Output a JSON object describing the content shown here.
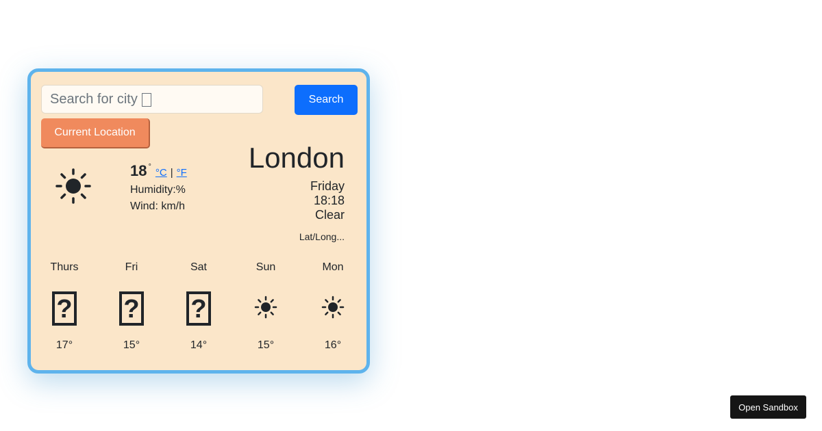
{
  "search": {
    "placeholder": "Search for city",
    "placeholder_glyph": "?",
    "button_label": "Search"
  },
  "location_button_label": "Current Location",
  "current": {
    "icon": "sun-icon",
    "temperature": "18",
    "degree_symbol": "°",
    "unit_celsius": "°C",
    "unit_separator": "|",
    "unit_fahrenheit": "°F",
    "humidity": "Humidity:%",
    "wind": "Wind: km/h",
    "city": "London",
    "day": "Friday",
    "time": "18:18",
    "description": "Clear",
    "latlong": "Lat/Long..."
  },
  "forecast": [
    {
      "day": "Thurs",
      "temp": "17°",
      "icon": "missing-glyph-icon"
    },
    {
      "day": "Fri",
      "temp": "15°",
      "icon": "missing-glyph-icon"
    },
    {
      "day": "Sat",
      "temp": "14°",
      "icon": "missing-glyph-icon"
    },
    {
      "day": "Sun",
      "temp": "15°",
      "icon": "sun-icon"
    },
    {
      "day": "Mon",
      "temp": "16°",
      "icon": "sun-icon"
    }
  ],
  "sandbox_button_label": "Open Sandbox",
  "colors": {
    "card_background": "#fbe6c9",
    "card_border": "#5eb3ec",
    "search_button": "#0d6efd",
    "location_button": "#f08a5d",
    "sandbox_button": "#151515"
  }
}
